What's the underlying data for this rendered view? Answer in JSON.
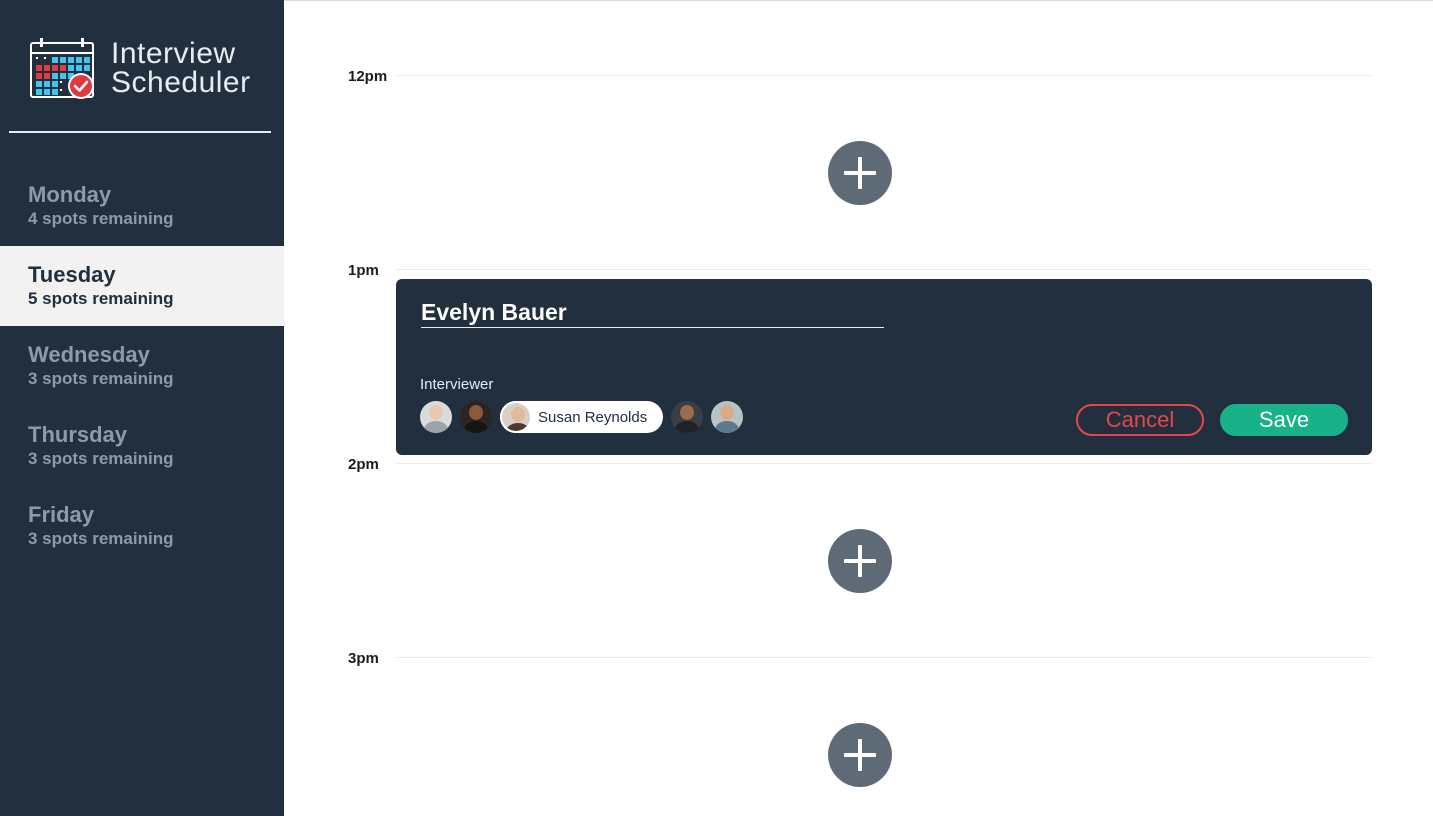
{
  "sidebar": {
    "app_title": "Interview\nScheduler",
    "logo_icon": "calendar-check-icon",
    "days": [
      {
        "name": "Monday",
        "spots": "4 spots remaining",
        "selected": false
      },
      {
        "name": "Tuesday",
        "spots": "5 spots remaining",
        "selected": true
      },
      {
        "name": "Wednesday",
        "spots": "3 spots remaining",
        "selected": false
      },
      {
        "name": "Thursday",
        "spots": "3 spots remaining",
        "selected": false
      },
      {
        "name": "Friday",
        "spots": "3 spots remaining",
        "selected": false
      }
    ]
  },
  "schedule": {
    "times": [
      "12pm",
      "1pm",
      "2pm",
      "3pm"
    ],
    "add_icon": "plus-icon",
    "form": {
      "student_name": "Evelyn Bauer",
      "interviewer_heading": "Interviewer",
      "selected_interviewer": "Susan Reynolds",
      "cancel_label": "Cancel",
      "save_label": "Save"
    }
  },
  "colors": {
    "sidebar_bg": "#222f3e",
    "selected_day_bg": "#f2f2f2",
    "add_button": "#5f6a77",
    "cancel": "#e8454b",
    "save": "#17b289"
  }
}
